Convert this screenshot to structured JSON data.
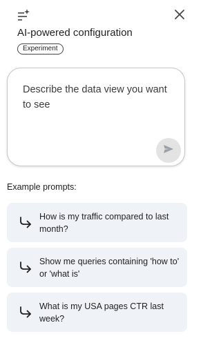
{
  "header": {
    "title": "AI-powered configuration",
    "badge": "Experiment",
    "leading_icon": "sparkle-filter-icon",
    "close_icon": "close-icon"
  },
  "prompt": {
    "placeholder": "Describe the data view you want to see",
    "value": "",
    "send_icon": "send-icon"
  },
  "examples": {
    "heading": "Example prompts:",
    "item_icon": "subdirectory-arrow-right-icon",
    "items": [
      {
        "text": "How is my traffic compared to last month?"
      },
      {
        "text": "Show me queries containing 'how to' or 'what is'"
      },
      {
        "text": "What is my USA pages CTR last week?"
      }
    ]
  },
  "colors": {
    "card_background": "#eff2f7",
    "send_button_background": "#e3e3e3",
    "text": "#1f1f1f"
  }
}
